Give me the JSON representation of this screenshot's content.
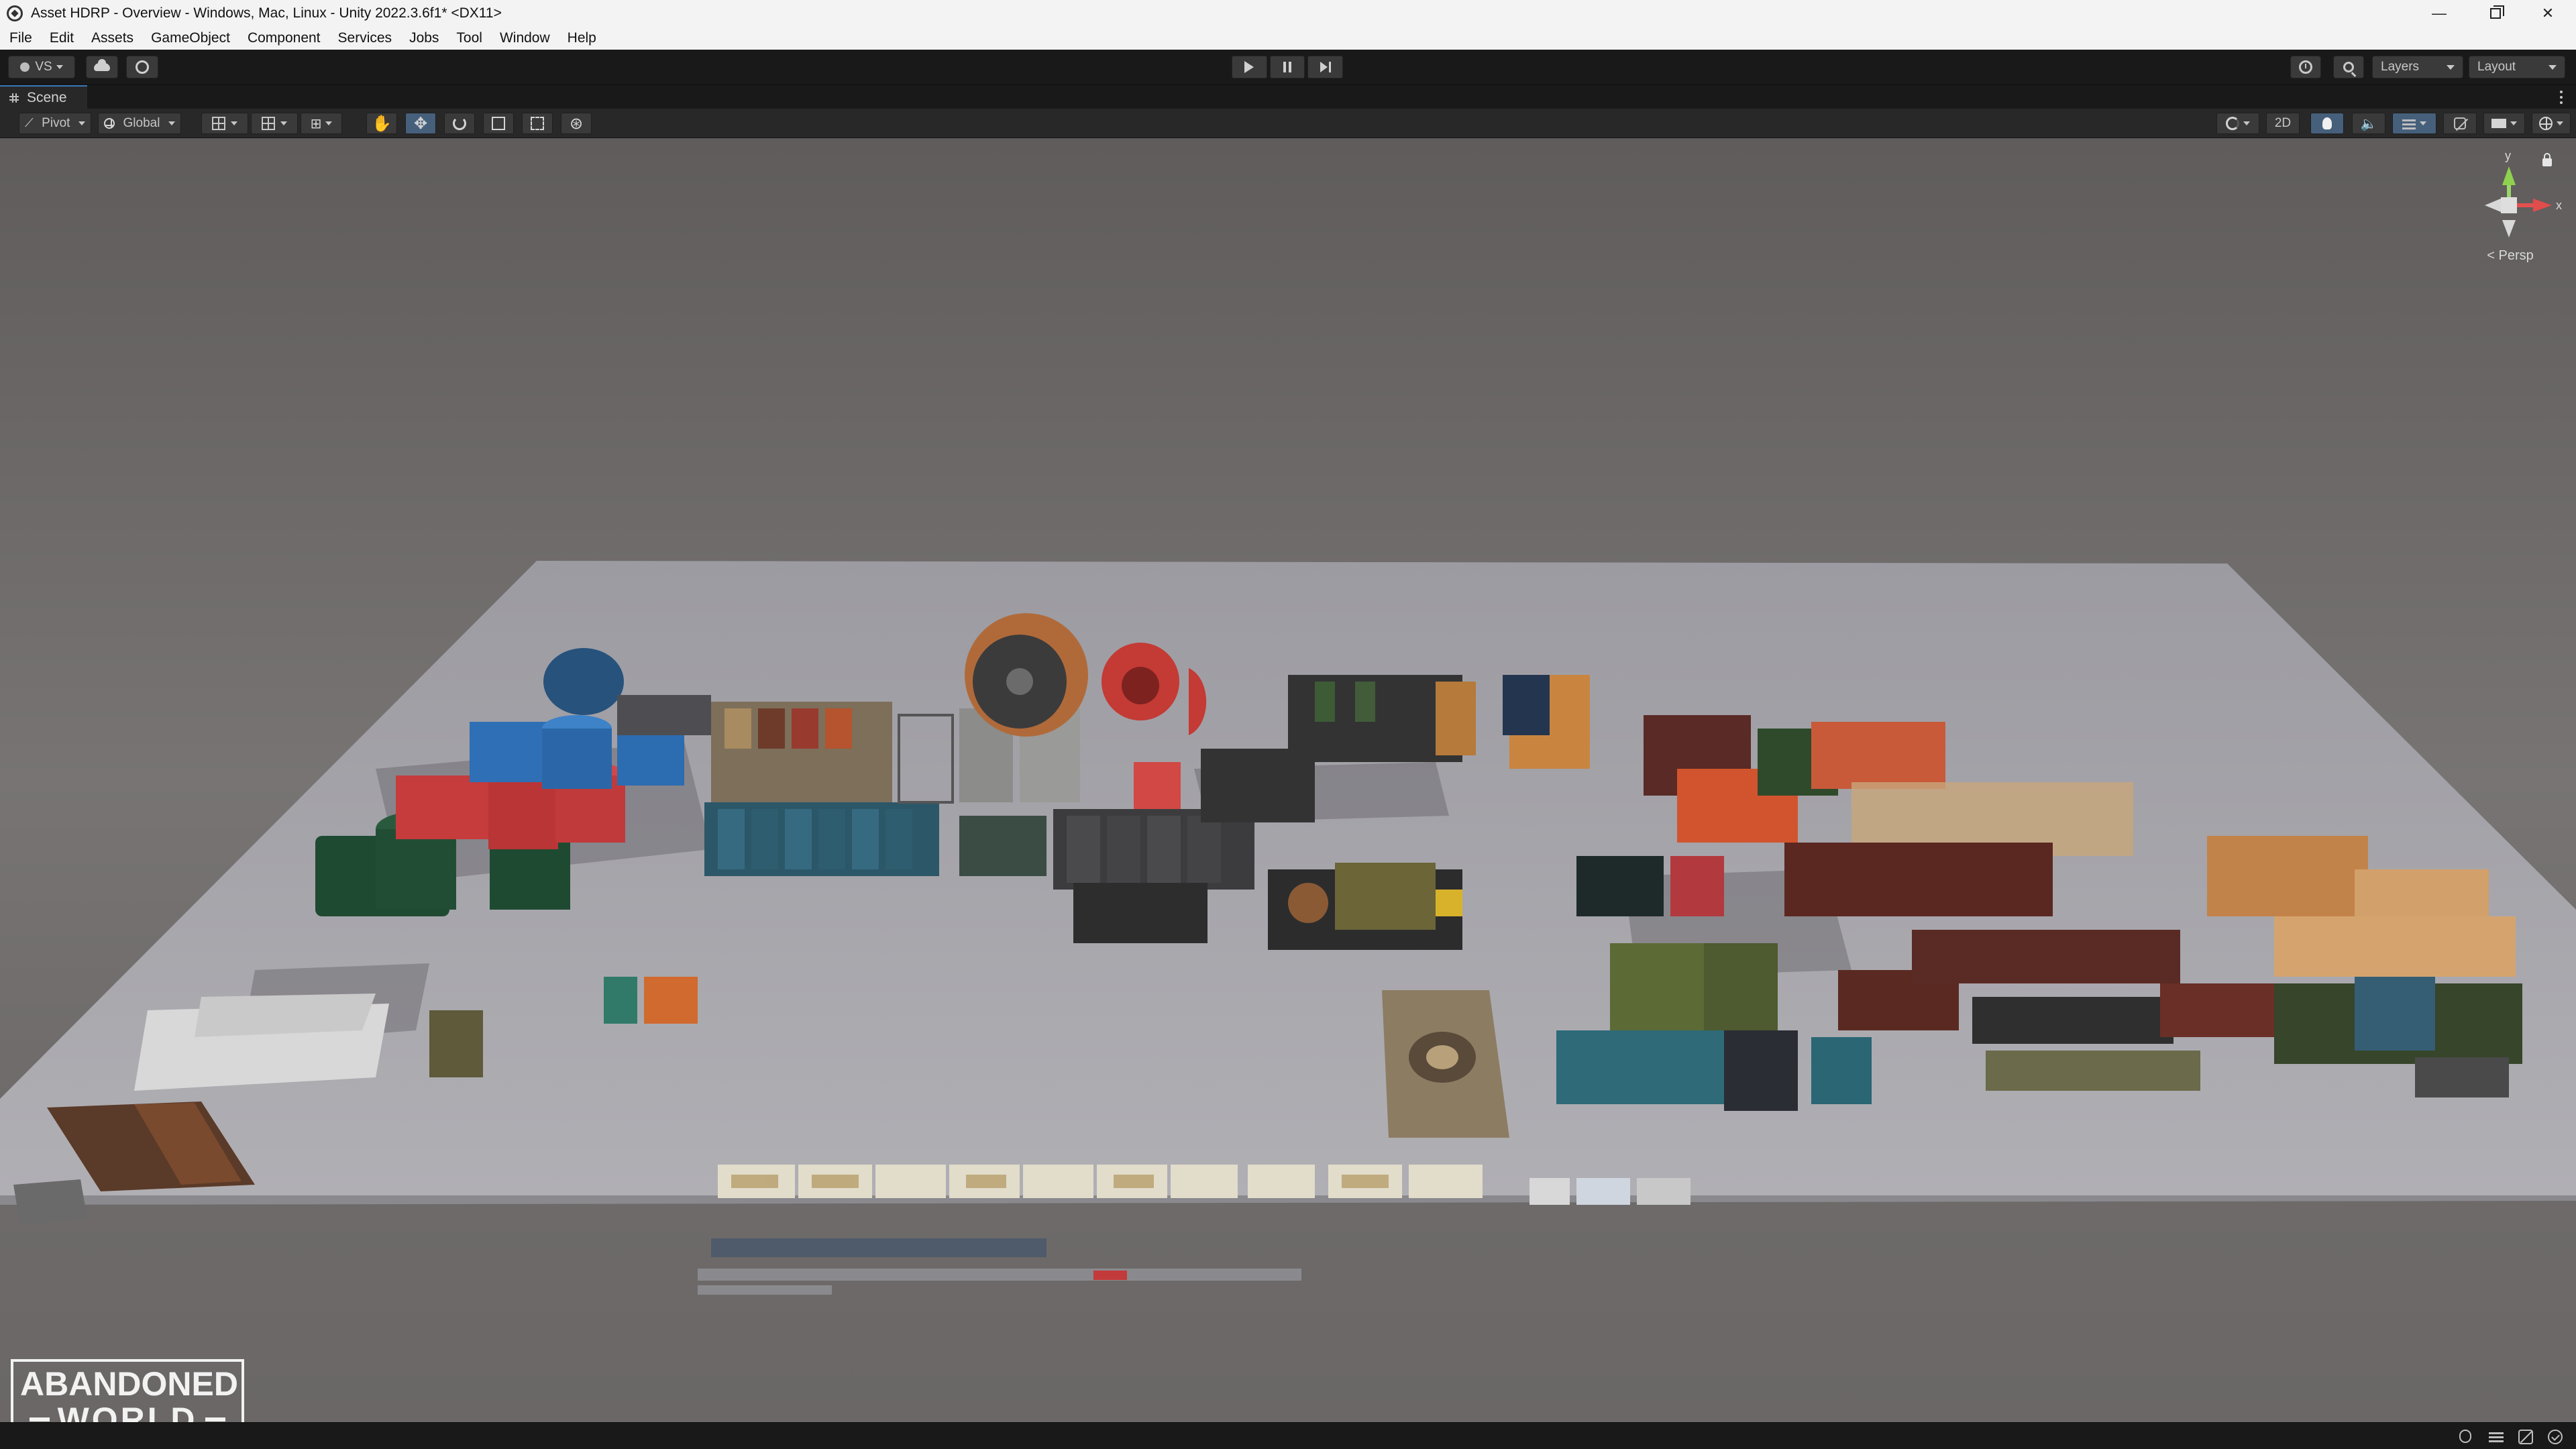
{
  "window": {
    "title": "Asset HDRP - Overview - Windows, Mac, Linux - Unity 2022.3.6f1* <DX11>",
    "minimize_glyph": "—",
    "close_glyph": "✕"
  },
  "menu": [
    "File",
    "Edit",
    "Assets",
    "GameObject",
    "Component",
    "Services",
    "Jobs",
    "Tool",
    "Window",
    "Help"
  ],
  "toolbar": {
    "account_label": "VS",
    "layers_label": "Layers",
    "layout_label": "Layout"
  },
  "scene": {
    "tab_label": "Scene",
    "pivot_label": "Pivot",
    "global_label": "Global",
    "btn_2d_label": "2D",
    "persp_label": "< Persp",
    "gizmo_axes": {
      "y": "y",
      "x": "x"
    }
  },
  "logo": {
    "line1": "ABANDONED",
    "line2": "WORLD"
  },
  "colors": {
    "accent": "#3a79bb",
    "axis_x": "#e14c4c",
    "axis_y": "#8fd14f",
    "floor": "#a9a8ad"
  },
  "icons": {
    "app": "unity-icon",
    "hand": "hand-icon",
    "move": "move-icon",
    "rotate": "rotate-icon",
    "scale": "scale-icon",
    "rect": "rect-icon",
    "transform": "transform-icon"
  }
}
